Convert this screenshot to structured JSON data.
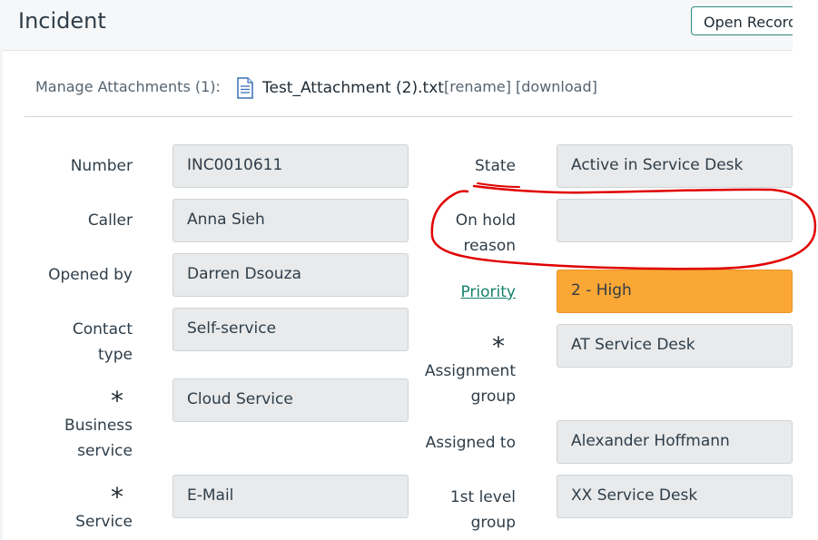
{
  "header": {
    "title": "Incident",
    "open_record_label": "Open Record"
  },
  "attachments": {
    "label": "Manage Attachments (1):",
    "file_name": "Test_Attachment (2).txt",
    "rename_label": "[rename]",
    "download_label": "[download]",
    "file_icon": "text-file-icon"
  },
  "form": {
    "left": [
      {
        "label": "Number",
        "value": "INC0010611"
      },
      {
        "label_lines": [
          "Caller"
        ],
        "value": "Anna Sieh"
      },
      {
        "label": "Opened by",
        "value": "Darren Dsouza"
      },
      {
        "label_lines": [
          "Contact",
          "type"
        ],
        "value": "Self-service"
      },
      {
        "label_lines": [
          "Business",
          "service"
        ],
        "value": "Cloud Service",
        "required": true
      },
      {
        "label": "Service",
        "value": "E-Mail",
        "required": true
      }
    ],
    "right": [
      {
        "label": "State",
        "value": "Active in Service Desk"
      },
      {
        "label_lines": [
          "On hold",
          "reason"
        ],
        "value": ""
      },
      {
        "label": "Priority",
        "value": "2 - High",
        "color": "#fba736"
      },
      {
        "label_lines": [
          "Assignment",
          "group"
        ],
        "value": "AT Service Desk",
        "required": true
      },
      {
        "label": "Assigned to",
        "value": "Alexander Hoffmann"
      },
      {
        "label_lines": [
          "1st level",
          "group"
        ],
        "value": "XX Service Desk"
      }
    ],
    "required_marker": "*"
  },
  "annotation": {
    "shape": "freehand-ellipse",
    "color": "#e00000",
    "target": "On hold reason"
  }
}
